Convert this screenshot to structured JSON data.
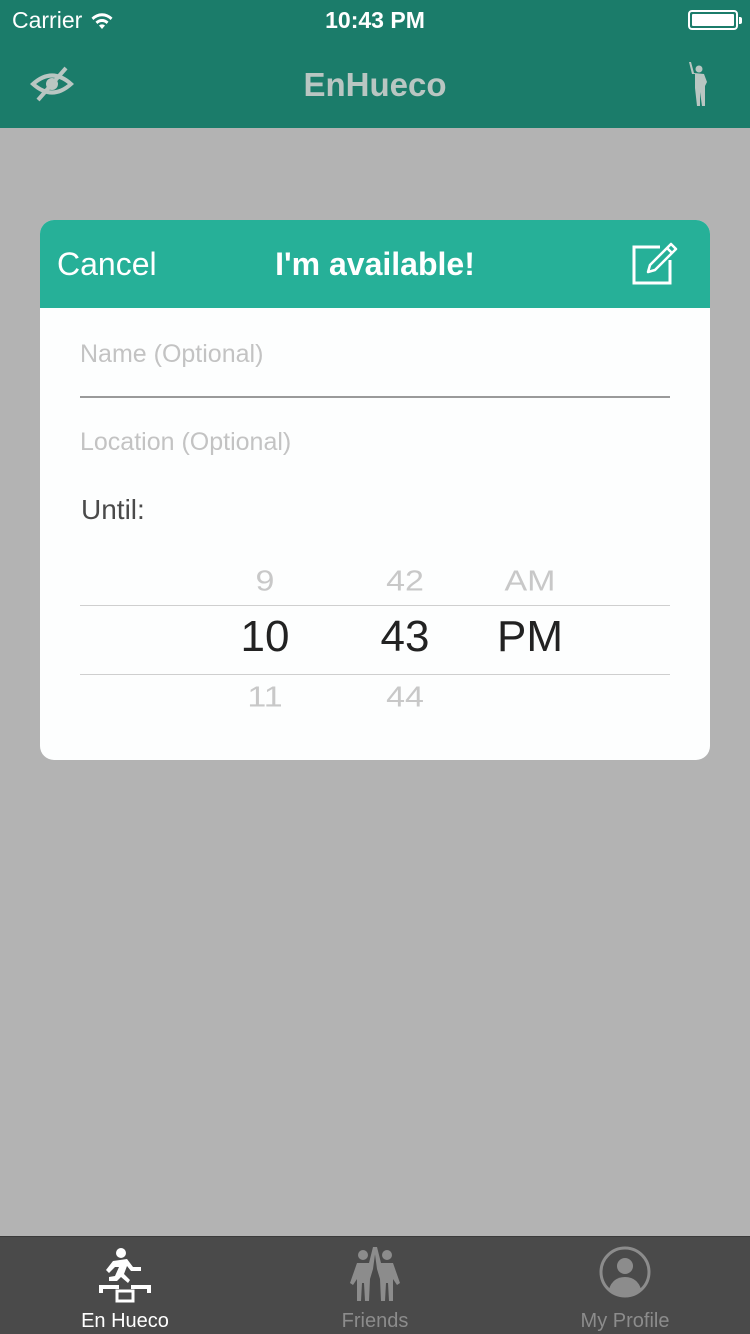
{
  "status_bar": {
    "carrier": "Carrier",
    "time": "10:43 PM",
    "wifi_icon": "wifi-icon",
    "battery_icon": "battery-icon"
  },
  "nav": {
    "title": "EnHueco",
    "left_icon": "eye-slash-icon",
    "right_icon": "person-waving-icon",
    "color": "#1b7c6a"
  },
  "modal": {
    "cancel_label": "Cancel",
    "title": "I'm available!",
    "edit_icon": "edit-icon",
    "header_color": "#26b098",
    "name_placeholder": "Name (Optional)",
    "location_placeholder": "Location (Optional)",
    "until_label": "Until:",
    "picker": {
      "hour": {
        "prev": "9",
        "current": "10",
        "next": "11"
      },
      "minute": {
        "prev": "42",
        "current": "43",
        "next": "44"
      },
      "ampm": {
        "prev": "AM",
        "current": "PM",
        "next": ""
      }
    }
  },
  "tabbar": {
    "tabs": [
      {
        "label": "En Hueco",
        "icon": "en-hueco-icon",
        "active": true
      },
      {
        "label": "Friends",
        "icon": "friends-icon",
        "active": false
      },
      {
        "label": "My Profile",
        "icon": "profile-icon",
        "active": false
      }
    ]
  }
}
